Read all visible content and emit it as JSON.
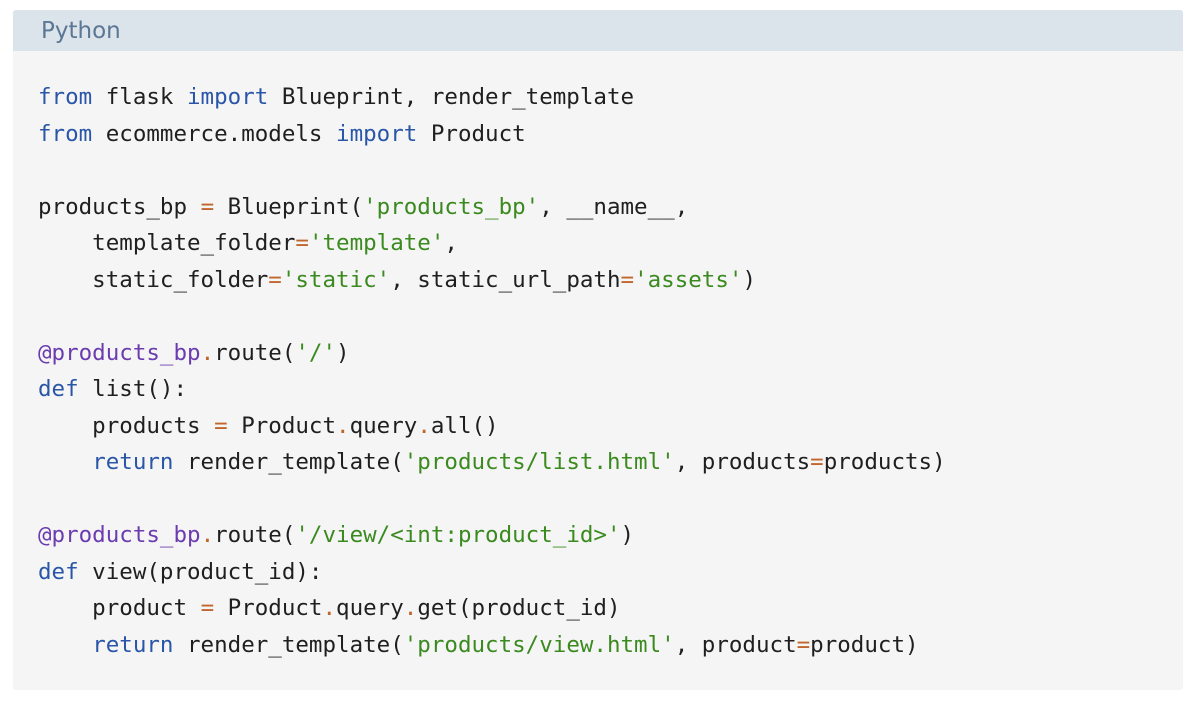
{
  "language_label": "Python",
  "lines": [
    [
      {
        "t": "from",
        "c": "kw"
      },
      {
        "t": " flask ",
        "c": "pl"
      },
      {
        "t": "import",
        "c": "kw"
      },
      {
        "t": " Blueprint, render_template",
        "c": "pl"
      }
    ],
    [
      {
        "t": "from",
        "c": "kw"
      },
      {
        "t": " ecommerce.models ",
        "c": "pl"
      },
      {
        "t": "import",
        "c": "kw"
      },
      {
        "t": " Product",
        "c": "pl"
      }
    ],
    [],
    [
      {
        "t": "products_bp ",
        "c": "pl"
      },
      {
        "t": "=",
        "c": "op"
      },
      {
        "t": " Blueprint(",
        "c": "pl"
      },
      {
        "t": "'products_bp'",
        "c": "str"
      },
      {
        "t": ", __name__,",
        "c": "pl"
      }
    ],
    [
      {
        "t": "    template_folder",
        "c": "pl"
      },
      {
        "t": "=",
        "c": "op"
      },
      {
        "t": "'template'",
        "c": "str"
      },
      {
        "t": ",",
        "c": "pl"
      }
    ],
    [
      {
        "t": "    static_folder",
        "c": "pl"
      },
      {
        "t": "=",
        "c": "op"
      },
      {
        "t": "'static'",
        "c": "str"
      },
      {
        "t": ", static_url_path",
        "c": "pl"
      },
      {
        "t": "=",
        "c": "op"
      },
      {
        "t": "'assets'",
        "c": "str"
      },
      {
        "t": ")",
        "c": "pl"
      }
    ],
    [],
    [
      {
        "t": "@products_bp",
        "c": "dec"
      },
      {
        "t": ".",
        "c": "op"
      },
      {
        "t": "route(",
        "c": "pl"
      },
      {
        "t": "'/'",
        "c": "str"
      },
      {
        "t": ")",
        "c": "pl"
      }
    ],
    [
      {
        "t": "def",
        "c": "kw"
      },
      {
        "t": " list():",
        "c": "pl"
      }
    ],
    [
      {
        "t": "    products ",
        "c": "pl"
      },
      {
        "t": "=",
        "c": "op"
      },
      {
        "t": " Product",
        "c": "pl"
      },
      {
        "t": ".",
        "c": "op"
      },
      {
        "t": "query",
        "c": "pl"
      },
      {
        "t": ".",
        "c": "op"
      },
      {
        "t": "all()",
        "c": "pl"
      }
    ],
    [
      {
        "t": "    ",
        "c": "pl"
      },
      {
        "t": "return",
        "c": "kw"
      },
      {
        "t": " render_template(",
        "c": "pl"
      },
      {
        "t": "'products/list.html'",
        "c": "str"
      },
      {
        "t": ", products",
        "c": "pl"
      },
      {
        "t": "=",
        "c": "op"
      },
      {
        "t": "products)",
        "c": "pl"
      }
    ],
    [],
    [
      {
        "t": "@products_bp",
        "c": "dec"
      },
      {
        "t": ".",
        "c": "op"
      },
      {
        "t": "route(",
        "c": "pl"
      },
      {
        "t": "'/view/<int:product_id>'",
        "c": "str"
      },
      {
        "t": ")",
        "c": "pl"
      }
    ],
    [
      {
        "t": "def",
        "c": "kw"
      },
      {
        "t": " view(product_id):",
        "c": "pl"
      }
    ],
    [
      {
        "t": "    product ",
        "c": "pl"
      },
      {
        "t": "=",
        "c": "op"
      },
      {
        "t": " Product",
        "c": "pl"
      },
      {
        "t": ".",
        "c": "op"
      },
      {
        "t": "query",
        "c": "pl"
      },
      {
        "t": ".",
        "c": "op"
      },
      {
        "t": "get(product_id)",
        "c": "pl"
      }
    ],
    [
      {
        "t": "    ",
        "c": "pl"
      },
      {
        "t": "return",
        "c": "kw"
      },
      {
        "t": " render_template(",
        "c": "pl"
      },
      {
        "t": "'products/view.html'",
        "c": "str"
      },
      {
        "t": ", product",
        "c": "pl"
      },
      {
        "t": "=",
        "c": "op"
      },
      {
        "t": "product)",
        "c": "pl"
      }
    ]
  ]
}
